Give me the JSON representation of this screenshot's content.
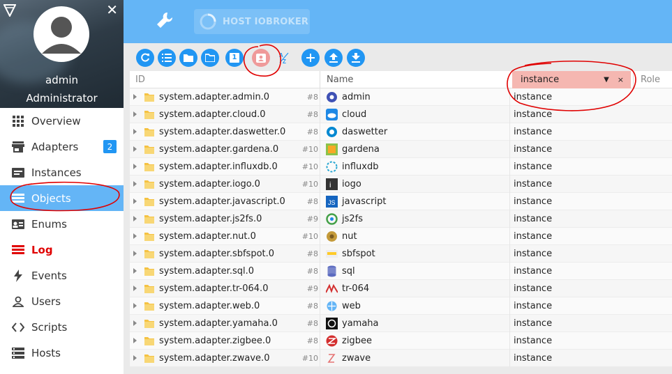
{
  "user": {
    "name": "admin",
    "role": "Administrator"
  },
  "nav": [
    {
      "label": "Overview",
      "icon": "grid-icon"
    },
    {
      "label": "Adapters",
      "icon": "store-icon",
      "badge": "2"
    },
    {
      "label": "Instances",
      "icon": "instances-icon"
    },
    {
      "label": "Objects",
      "icon": "list-icon",
      "active": true
    },
    {
      "label": "Enums",
      "icon": "id-card-icon"
    },
    {
      "label": "Log",
      "icon": "log-icon"
    },
    {
      "label": "Events",
      "icon": "bolt-icon"
    },
    {
      "label": "Users",
      "icon": "user-icon"
    },
    {
      "label": "Scripts",
      "icon": "code-icon"
    },
    {
      "label": "Hosts",
      "icon": "server-icon"
    }
  ],
  "topbar": {
    "host_label": "HOST IOBROKER"
  },
  "toolbar": {
    "tools": [
      "refresh",
      "list-view",
      "folder",
      "folder-open",
      "count-1",
      "custom-state",
      "sort-az",
      "add",
      "upload",
      "download"
    ],
    "count_label": "1"
  },
  "table": {
    "headers": {
      "id": "ID",
      "name": "Name",
      "role": "Role"
    },
    "type_filter": {
      "value": "instance",
      "clear": "×",
      "arrow": "▼"
    },
    "rows": [
      {
        "id": "system.adapter.admin.0",
        "count": "#8",
        "name": "admin",
        "type": "instance",
        "icon": "admin-icon"
      },
      {
        "id": "system.adapter.cloud.0",
        "count": "#8",
        "name": "cloud",
        "type": "instance",
        "icon": "cloud-icon"
      },
      {
        "id": "system.adapter.daswetter.0",
        "count": "#8",
        "name": "daswetter",
        "type": "instance",
        "icon": "weather-icon"
      },
      {
        "id": "system.adapter.gardena.0",
        "count": "#10",
        "name": "gardena",
        "type": "instance",
        "icon": "gardena-icon"
      },
      {
        "id": "system.adapter.influxdb.0",
        "count": "#10",
        "name": "influxdb",
        "type": "instance",
        "icon": "influxdb-icon"
      },
      {
        "id": "system.adapter.iogo.0",
        "count": "#10",
        "name": "iogo",
        "type": "instance",
        "icon": "iogo-icon"
      },
      {
        "id": "system.adapter.javascript.0",
        "count": "#8",
        "name": "javascript",
        "type": "instance",
        "icon": "javascript-icon"
      },
      {
        "id": "system.adapter.js2fs.0",
        "count": "#9",
        "name": "js2fs",
        "type": "instance",
        "icon": "js2fs-icon"
      },
      {
        "id": "system.adapter.nut.0",
        "count": "#10",
        "name": "nut",
        "type": "instance",
        "icon": "nut-icon"
      },
      {
        "id": "system.adapter.sbfspot.0",
        "count": "#8",
        "name": "sbfspot",
        "type": "instance",
        "icon": "sbfspot-icon"
      },
      {
        "id": "system.adapter.sql.0",
        "count": "#8",
        "name": "sql",
        "type": "instance",
        "icon": "database-icon"
      },
      {
        "id": "system.adapter.tr-064.0",
        "count": "#9",
        "name": "tr-064",
        "type": "instance",
        "icon": "avm-icon"
      },
      {
        "id": "system.adapter.web.0",
        "count": "#8",
        "name": "web",
        "type": "instance",
        "icon": "web-icon"
      },
      {
        "id": "system.adapter.yamaha.0",
        "count": "#8",
        "name": "yamaha",
        "type": "instance",
        "icon": "yamaha-icon"
      },
      {
        "id": "system.adapter.zigbee.0",
        "count": "#8",
        "name": "zigbee",
        "type": "instance",
        "icon": "zigbee-icon"
      },
      {
        "id": "system.adapter.zwave.0",
        "count": "#10",
        "name": "zwave",
        "type": "instance",
        "icon": "zwave-icon"
      }
    ]
  },
  "colors": {
    "accent": "#64b5f6",
    "button": "#2196f3",
    "active_button": "#ef9a9a",
    "filter_bg": "#f5b7b1",
    "log": "#e00000",
    "annotation": "#e00000"
  }
}
